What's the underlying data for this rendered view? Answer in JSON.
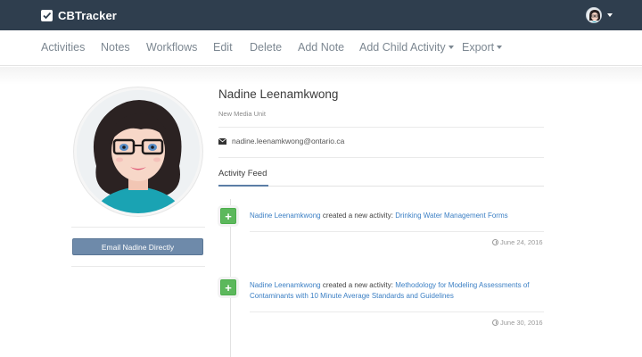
{
  "app": {
    "brand": "CBTracker"
  },
  "nav": {
    "items": [
      {
        "label": "Activities",
        "dropdown": false
      },
      {
        "label": "Notes",
        "dropdown": false
      },
      {
        "label": "Workflows",
        "dropdown": false
      },
      {
        "label": "Edit",
        "dropdown": false
      },
      {
        "label": "Delete",
        "dropdown": false
      },
      {
        "label": "Add Note",
        "dropdown": false
      },
      {
        "label": "Add Child Activity",
        "dropdown": true
      },
      {
        "label": "Export",
        "dropdown": true
      }
    ]
  },
  "profile": {
    "name": "Nadine Leenamkwong",
    "unit": "New Media Unit",
    "email": "nadine.leenamkwong@ontario.ca",
    "email_button": "Email Nadine Directly"
  },
  "feed": {
    "title": "Activity Feed",
    "entries": [
      {
        "actor": "Nadine Leenamkwong",
        "action": " created a new activity: ",
        "activity": "Drinking Water Management Forms",
        "date": "June 24, 2016"
      },
      {
        "actor": "Nadine Leenamkwong",
        "action": " created a new activity: ",
        "activity": "Methodology for Modeling Assessments of Contaminants with 10 Minute Average Standards and Guidelines",
        "date": "June 30, 2016"
      }
    ]
  },
  "colors": {
    "navbar": "#2f3e4e",
    "button": "#6e8aaa",
    "link": "#3b7fc4",
    "plus": "#5cb85c"
  }
}
